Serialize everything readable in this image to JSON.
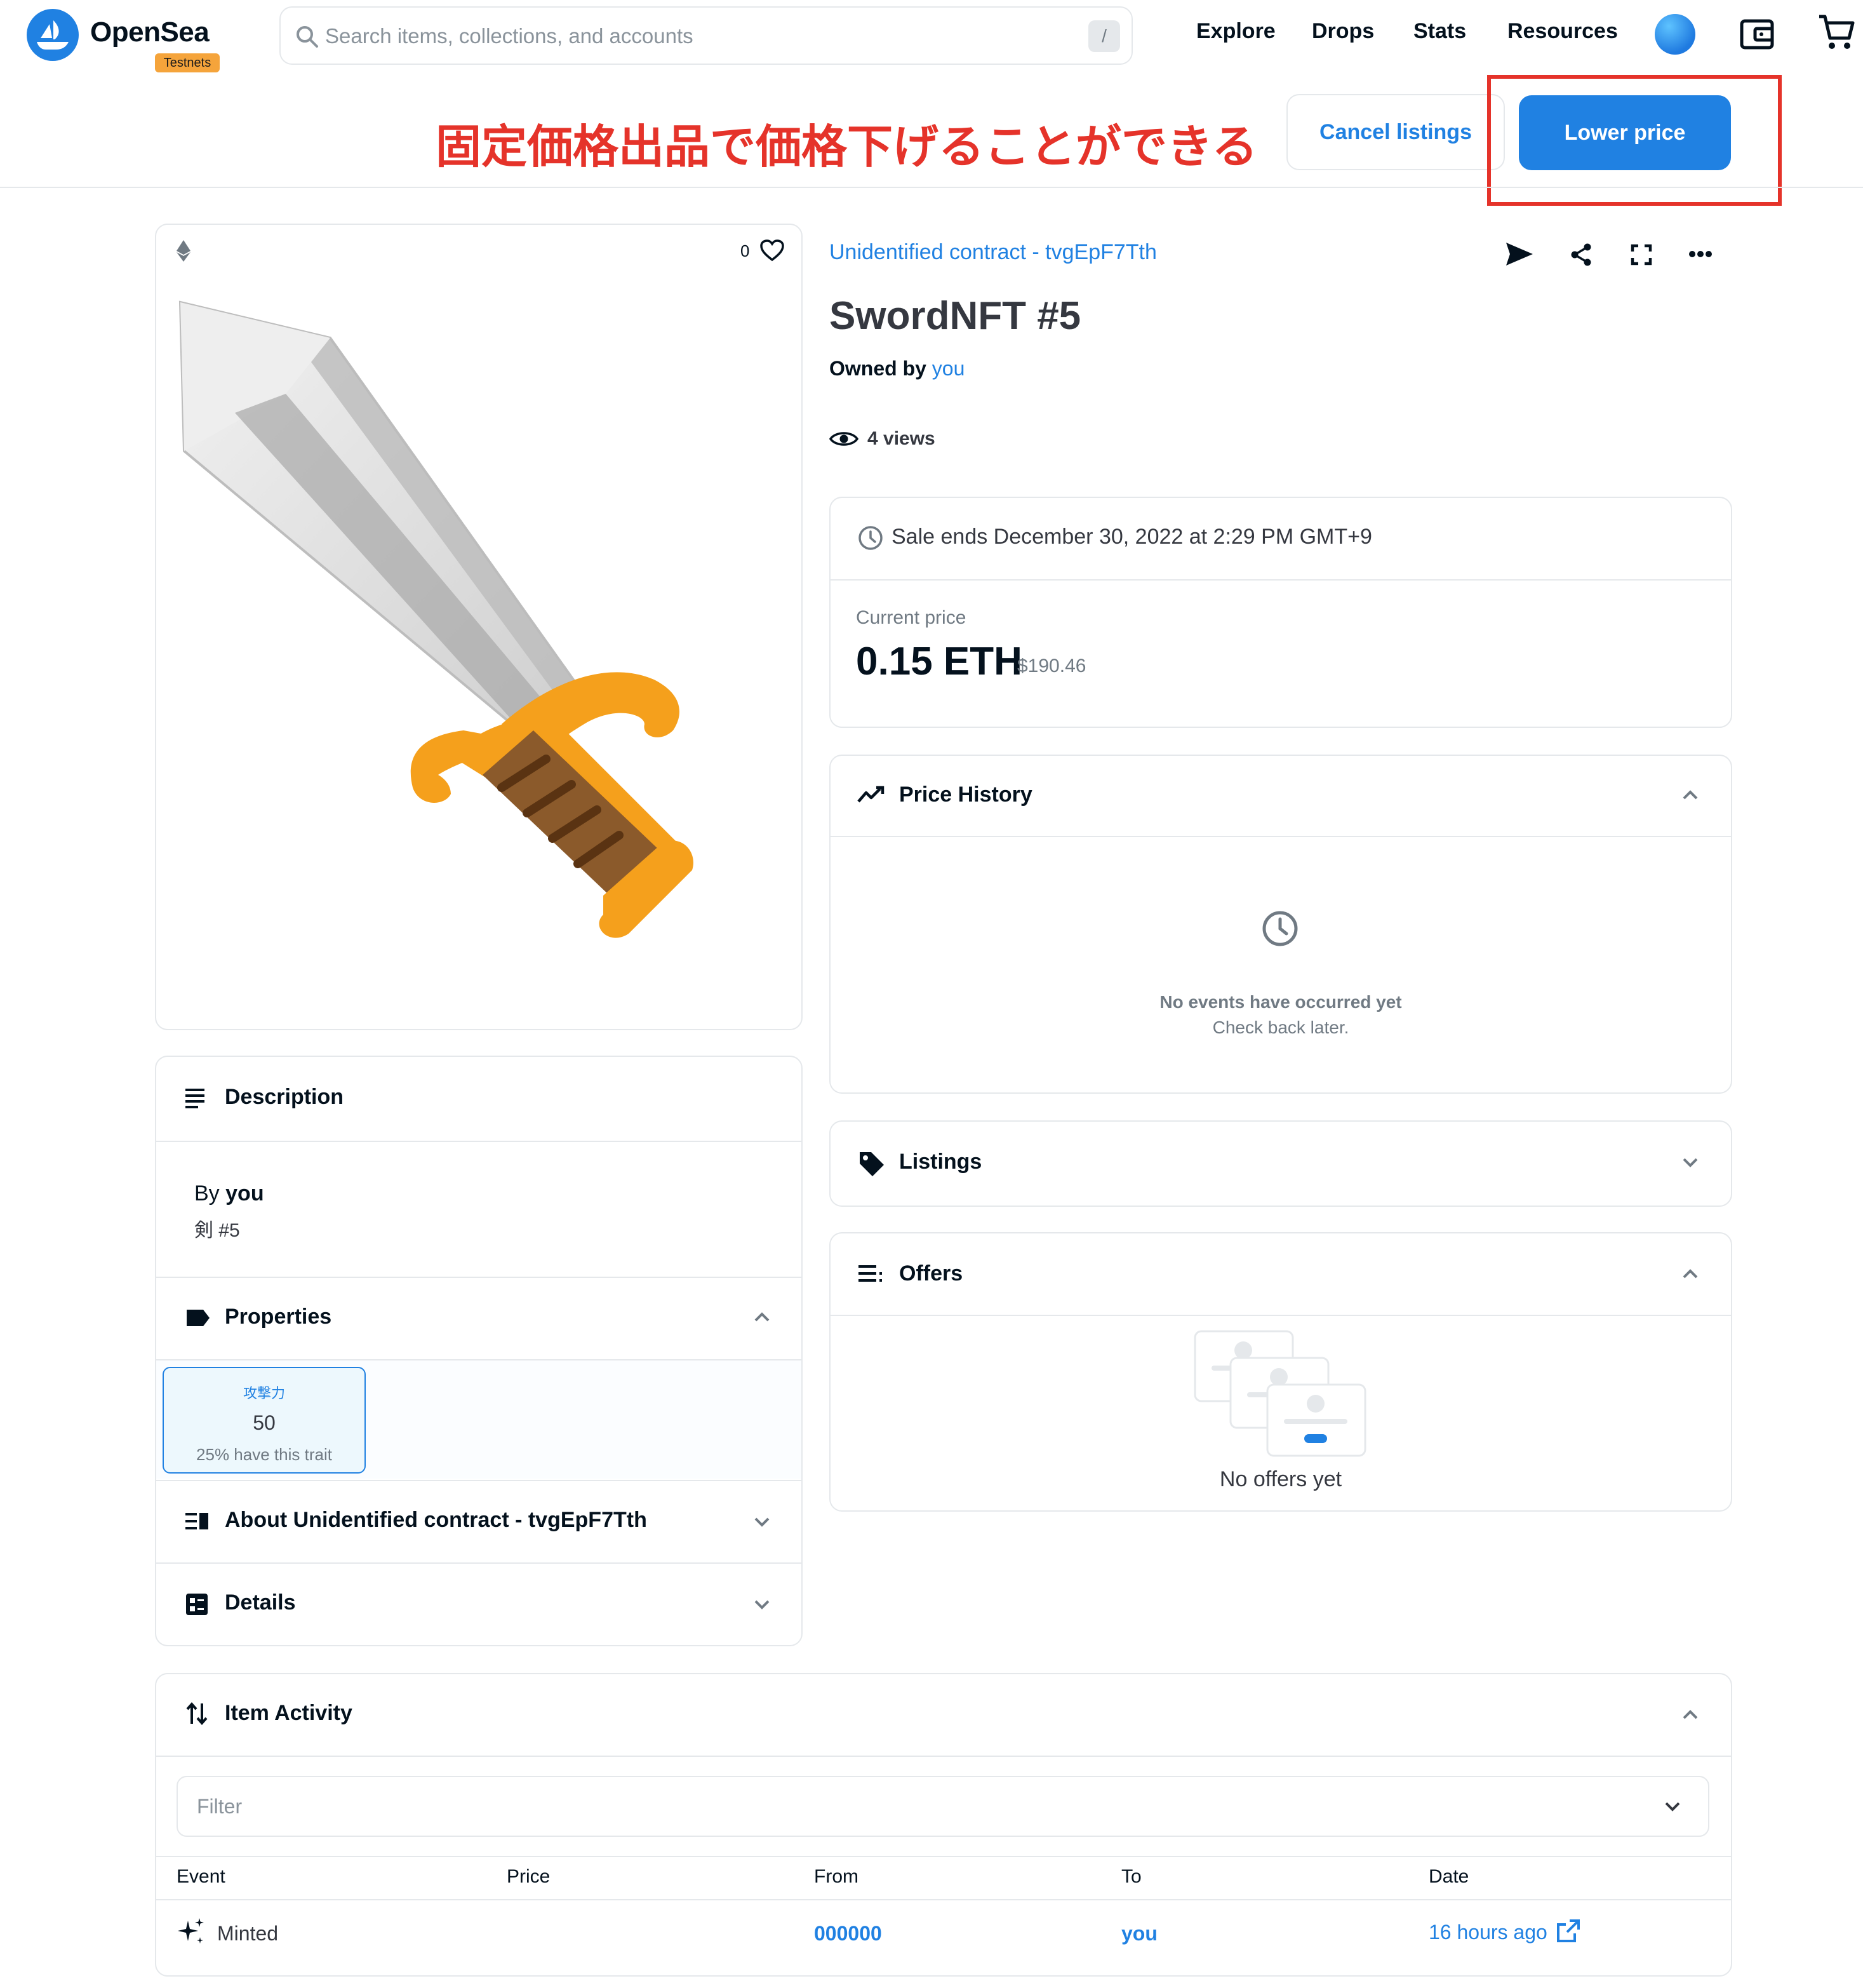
{
  "colors": {
    "accent": "#2081e2",
    "annotation_red": "#e5332a",
    "testnet_badge": "#f5a43b",
    "text": "#04111d",
    "muted": "#707a83",
    "border": "#e5e8eb"
  },
  "header": {
    "logo_text": "OpenSea",
    "badge": "Testnets",
    "search_placeholder": "Search items, collections, and accounts",
    "search_shortcut": "/",
    "nav": [
      "Explore",
      "Drops",
      "Stats",
      "Resources"
    ],
    "icons": [
      "avatar",
      "wallet-icon",
      "cart-icon"
    ]
  },
  "annotation": "固定価格出品で価格下げることができる",
  "owner_actions": {
    "cancel_label": "Cancel listings",
    "lower_label": "Lower price"
  },
  "asset": {
    "chain_icon": "ethereum-icon",
    "favorites": "0",
    "collection": "Unidentified contract - tvgEpF7Tth",
    "title": "SwordNFT #5",
    "owned_by_label": "Owned by",
    "owner": "you",
    "views": "4 views"
  },
  "sale": {
    "ends": "Sale ends December 30, 2022 at 2:29 PM GMT+9",
    "current_price_label": "Current price",
    "price": "0.15 ETH",
    "fiat": "$190.46"
  },
  "price_history": {
    "title": "Price History",
    "empty_title": "No events have occurred yet",
    "empty_sub": "Check back later."
  },
  "listings": {
    "title": "Listings"
  },
  "offers": {
    "title": "Offers",
    "empty": "No offers yet"
  },
  "description": {
    "title": "Description",
    "by_label": "By",
    "by_owner": "you",
    "text": "剣 #5"
  },
  "properties": {
    "title": "Properties",
    "items": [
      {
        "type": "攻撃力",
        "value": "50",
        "rarity": "25% have this trait"
      }
    ]
  },
  "about": {
    "title": "About Unidentified contract - tvgEpF7Tth"
  },
  "details": {
    "title": "Details"
  },
  "activity": {
    "title": "Item Activity",
    "filter_placeholder": "Filter",
    "columns": [
      "Event",
      "Price",
      "From",
      "To",
      "Date"
    ],
    "rows": [
      {
        "event": "Minted",
        "price": "",
        "from": "000000",
        "to": "you",
        "date": "16 hours ago"
      }
    ]
  }
}
